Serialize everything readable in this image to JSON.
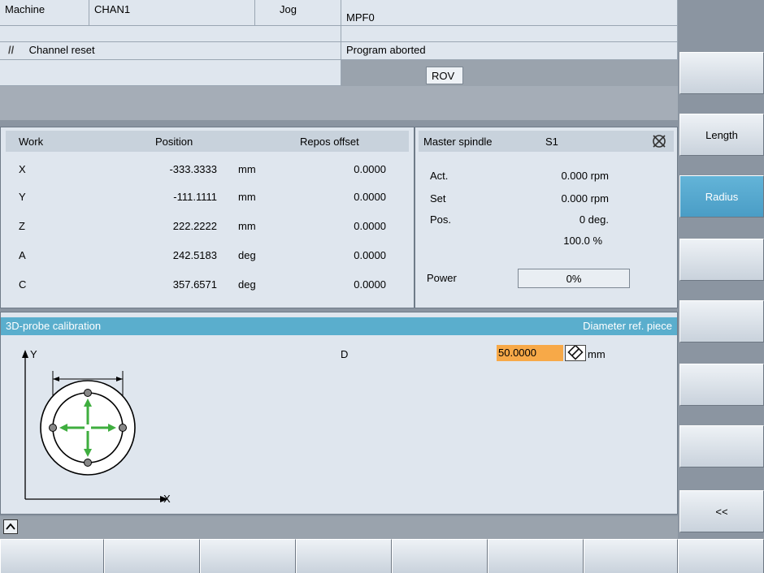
{
  "header": {
    "area": "Machine",
    "channel": "CHAN1",
    "mode": "Jog",
    "program": "MPF0",
    "channel_status": "Channel reset",
    "program_status": "Program aborted",
    "rov": "ROV"
  },
  "axes_table": {
    "col_work": "Work",
    "col_position": "Position",
    "col_repos": "Repos offset",
    "rows": [
      {
        "axis": "X",
        "position": "-333.3333",
        "unit": "mm",
        "repos": "0.0000"
      },
      {
        "axis": "Y",
        "position": "-111.1111",
        "unit": "mm",
        "repos": "0.0000"
      },
      {
        "axis": "Z",
        "position": "222.2222",
        "unit": "mm",
        "repos": "0.0000"
      },
      {
        "axis": "A",
        "position": "242.5183",
        "unit": "deg",
        "repos": "0.0000"
      },
      {
        "axis": "C",
        "position": "357.6571",
        "unit": "deg",
        "repos": "0.0000"
      }
    ]
  },
  "spindle": {
    "title": "Master spindle",
    "name": "S1",
    "act_label": "Act.",
    "act_value": "0.000 rpm",
    "set_label": "Set",
    "set_value": "0.000 rpm",
    "pos_label": "Pos.",
    "pos_value": "0 deg.",
    "override": "100.0 %",
    "power_label": "Power",
    "power_value": "0%"
  },
  "calibration": {
    "title": "3D-probe calibration",
    "subtitle": "Diameter ref. piece",
    "param_label": "D",
    "param_value": "50.0000",
    "param_unit": "mm",
    "axis_y": "Y",
    "axis_x": "X"
  },
  "softkeys": {
    "vertical": [
      "",
      "Length",
      "Radius",
      "",
      "",
      "",
      "",
      "<<"
    ],
    "active": "Radius"
  },
  "colors": {
    "accent": "#5aaecd",
    "input_highlight": "#f7a948",
    "panel_bg": "#dfe6ee",
    "frame_bg": "#8b95a1"
  }
}
